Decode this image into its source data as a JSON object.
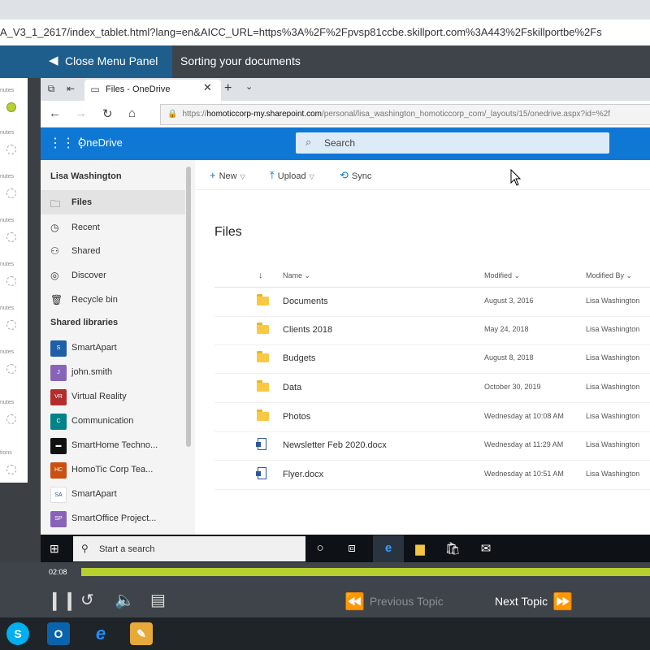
{
  "outer_browser": {
    "url": "A_V3_1_2617/index_tablet.html?lang=en&AICC_URL=https%3A%2F%2Fpvsp81ccbe.skillport.com%3A443%2Fskillportbe%2Fs"
  },
  "course": {
    "close_panel_label": "Close Menu Panel",
    "title": "Sorting your documents"
  },
  "progress_panel": {
    "items": [
      {
        "label": "nutes",
        "status": "complete"
      },
      {
        "label": "nutes",
        "status": "incomplete"
      },
      {
        "label": "nutes",
        "status": "incomplete"
      },
      {
        "label": "nutes",
        "status": "incomplete"
      },
      {
        "label": "nutes",
        "status": "incomplete"
      },
      {
        "label": "nutes",
        "status": "incomplete"
      },
      {
        "label": "nutes",
        "status": "incomplete"
      },
      {
        "label": "nutes",
        "status": "incomplete"
      },
      {
        "label": "tions",
        "status": "incomplete"
      }
    ]
  },
  "inner_browser": {
    "tab_title": "Files - OneDrive",
    "url_prefix": "https://",
    "url_host": "homoticcorp-my.sharepoint.com",
    "url_path": "/personal/lisa_washington_homoticcorp_com/_layouts/15/onedrive.aspx?id=%2f"
  },
  "onedrive": {
    "brand": "OneDrive",
    "search_placeholder": "Search",
    "user_name": "Lisa Washington",
    "nav_items": [
      {
        "label": "Files",
        "icon": "folder-icon",
        "active": true
      },
      {
        "label": "Recent",
        "icon": "clock-icon",
        "active": false
      },
      {
        "label": "Shared",
        "icon": "people-icon",
        "active": false
      },
      {
        "label": "Discover",
        "icon": "compass-icon",
        "active": false
      },
      {
        "label": "Recycle bin",
        "icon": "trash-icon",
        "active": false
      }
    ],
    "shared_libraries_heading": "Shared libraries",
    "libraries": [
      {
        "badge": "S",
        "label": "SmartApart",
        "color": "#1f5fa8"
      },
      {
        "badge": "J",
        "label": "john.smith",
        "color": "#8764b8"
      },
      {
        "badge": "VR",
        "label": "Virtual Reality",
        "color": "#b32d2d"
      },
      {
        "badge": "C",
        "label": "Communication",
        "color": "#038387"
      },
      {
        "badge": "",
        "label": "SmartHome Techno...",
        "color": "#111111"
      },
      {
        "badge": "HC",
        "label": "HomoTic Corp Tea...",
        "color": "#ca5010"
      },
      {
        "badge": "SA",
        "label": "SmartApart",
        "color": "#ffffff"
      },
      {
        "badge": "SP",
        "label": "SmartOffice Project...",
        "color": "#8764b8"
      }
    ],
    "commands": {
      "new": "New",
      "upload": "Upload",
      "sync": "Sync"
    },
    "files_title": "Files",
    "columns": {
      "name": "Name",
      "modified": "Modified",
      "modified_by": "Modified By"
    },
    "files": [
      {
        "type": "folder",
        "name": "Documents",
        "modified": "August 3, 2016",
        "modified_by": "Lisa Washington"
      },
      {
        "type": "folder",
        "name": "Clients 2018",
        "modified": "May 24, 2018",
        "modified_by": "Lisa Washington"
      },
      {
        "type": "folder",
        "name": "Budgets",
        "modified": "August 8, 2018",
        "modified_by": "Lisa Washington"
      },
      {
        "type": "folder",
        "name": "Data",
        "modified": "October 30, 2019",
        "modified_by": "Lisa Washington"
      },
      {
        "type": "folder",
        "name": "Photos",
        "modified": "Wednesday at 10:08 AM",
        "modified_by": "Lisa Washington"
      },
      {
        "type": "docx",
        "name": "Newsletter Feb 2020.docx",
        "modified": "Wednesday at 11:29 AM",
        "modified_by": "Lisa Washington"
      },
      {
        "type": "docx",
        "name": "Flyer.docx",
        "modified": "Wednesday at 10:51 AM",
        "modified_by": "Lisa Washington"
      }
    ]
  },
  "windows_taskbar": {
    "search_placeholder": "Start a search"
  },
  "player": {
    "time": "02:08",
    "progress": 1.0,
    "previous_topic_label": "Previous Topic",
    "next_topic_label": "Next Topic"
  },
  "host_taskbar": {
    "apps": [
      {
        "icon": "skype-icon",
        "letter": "S",
        "color": "#00aff0"
      },
      {
        "icon": "outlook-icon",
        "letter": "O",
        "color": "#0a64ad"
      },
      {
        "icon": "internet-explorer-icon",
        "letter": "e",
        "color": "#1e90ff"
      },
      {
        "icon": "paint-icon",
        "letter": "",
        "color": "#e6a93a"
      }
    ]
  }
}
